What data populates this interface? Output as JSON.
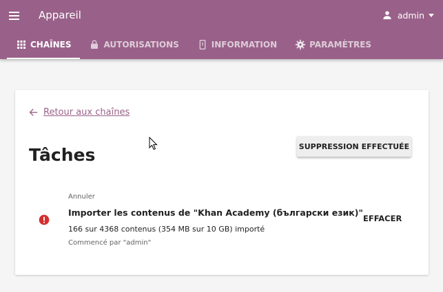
{
  "header": {
    "title": "Appareil",
    "menu_icon": "hamburger-menu-icon",
    "user": {
      "name": "admin",
      "icon": "person-icon"
    }
  },
  "tabs": [
    {
      "label": "CHAÎNES",
      "icon": "grid-icon",
      "active": true
    },
    {
      "label": "AUTORISATIONS",
      "icon": "lock-icon",
      "active": false
    },
    {
      "label": "INFORMATION",
      "icon": "device-icon",
      "active": false
    },
    {
      "label": "PARAMÈTRES",
      "icon": "gear-icon",
      "active": false
    }
  ],
  "page": {
    "back_link": "Retour aux chaînes",
    "heading": "Tâches",
    "clear_completed_label": "SUPPRESSION EFFECTUÉE"
  },
  "task": {
    "status": "error",
    "cancel_label": "Annuler",
    "title": "Importer les contenus de \"Khan Academy (български език)\"",
    "progress": "166 sur 4368 contenus (354 MB sur 10 GB) importé",
    "started_by": "Commencé par \"admin\"",
    "clear_label": "EFFACER"
  },
  "colors": {
    "brand": "#996189",
    "error": "#d32f2f",
    "background": "#f5f5f5"
  }
}
